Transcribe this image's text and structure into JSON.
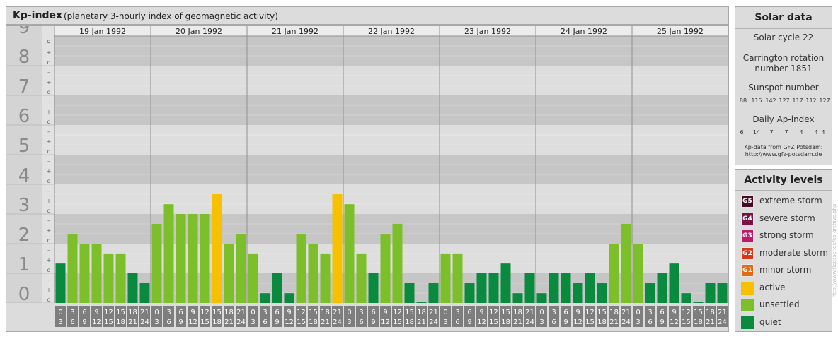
{
  "header": {
    "title": "Kp-index",
    "subtitle": "(planetary 3-hourly index of geomagnetic activity)"
  },
  "solar": {
    "title": "Solar data",
    "cycle": "Solar cycle 22",
    "carrington_line1": "Carrington rotation",
    "carrington_line2": "number 1851",
    "sunspot_label": "Sunspot number",
    "sunspot_values": [
      "88",
      "115",
      "142",
      "127",
      "117",
      "112",
      "127"
    ],
    "ap_label": "Daily Ap-index",
    "ap_values": [
      "6",
      "14",
      "7",
      "7",
      "4",
      "4",
      "4"
    ],
    "source_line1": "Kp-data from GFZ Potsdam:",
    "source_line2": "http://www.gfz-potsdam.de"
  },
  "legend": {
    "title": "Activity levels",
    "items": [
      {
        "badge": "G5",
        "label": "extreme storm",
        "color": "#4a0a26"
      },
      {
        "badge": "G4",
        "label": "severe storm",
        "color": "#7a1248"
      },
      {
        "badge": "G3",
        "label": "strong storm",
        "color": "#c2186a"
      },
      {
        "badge": "G2",
        "label": "moderate storm",
        "color": "#d83818"
      },
      {
        "badge": "G1",
        "label": "minor storm",
        "color": "#e86a10"
      },
      {
        "badge": "",
        "label": "active",
        "color": "#f7c000"
      },
      {
        "badge": "",
        "label": "unsettled",
        "color": "#7cbf2a"
      },
      {
        "badge": "",
        "label": "quiet",
        "color": "#0a8a3e"
      }
    ]
  },
  "credit": "http://www.fleusser.de/kp-archive.php",
  "chart_data": {
    "type": "bar",
    "ylim": [
      0,
      9
    ],
    "y_ticks": [
      "0",
      "1",
      "2",
      "3",
      "4",
      "5",
      "6",
      "7",
      "8",
      "9"
    ],
    "sub_ticks": [
      "o",
      "+",
      "–"
    ],
    "days": [
      "19 Jan 1992",
      "20 Jan 1992",
      "21 Jan 1992",
      "22 Jan 1992",
      "23 Jan 1992",
      "24 Jan 1992",
      "25 Jan 1992"
    ],
    "interval_starts": [
      "0",
      "3",
      "6",
      "9",
      "12",
      "15",
      "18",
      "21"
    ],
    "interval_ends": [
      "3",
      "6",
      "9",
      "12",
      "15",
      "18",
      "21",
      "24"
    ],
    "values": [
      [
        1.33,
        2.33,
        2.0,
        2.0,
        1.67,
        1.67,
        1.0,
        0.67
      ],
      [
        2.67,
        3.33,
        3.0,
        3.0,
        3.0,
        3.67,
        2.0,
        2.33
      ],
      [
        1.67,
        0.33,
        1.0,
        0.33,
        2.33,
        2.0,
        1.67,
        3.67
      ],
      [
        3.33,
        1.67,
        1.0,
        2.33,
        2.67,
        0.67,
        0.0,
        0.67
      ],
      [
        1.67,
        1.67,
        0.67,
        1.0,
        1.0,
        1.33,
        0.33,
        1.0
      ],
      [
        0.33,
        1.0,
        1.0,
        0.67,
        1.0,
        0.67,
        2.0,
        2.67
      ],
      [
        2.0,
        0.67,
        1.0,
        1.33,
        0.33,
        0.0,
        0.67,
        0.67
      ]
    ],
    "colors": {
      "quiet": "#0a8a3e",
      "unsettled": "#7cbf2a",
      "active": "#f7c000"
    }
  }
}
